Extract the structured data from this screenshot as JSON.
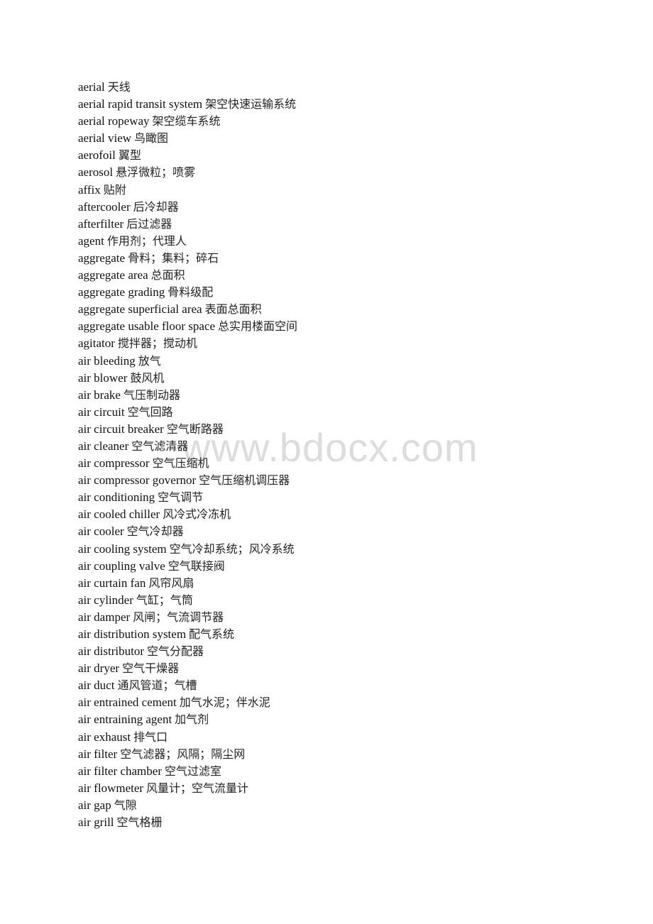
{
  "document": {
    "watermark": "www.bdocx.com",
    "entries": [
      {
        "term": "aerial",
        "definition": "天线"
      },
      {
        "term": "aerial rapid transit system",
        "definition": "架空快速运输系统"
      },
      {
        "term": "aerial ropeway",
        "definition": "架空缆车系统"
      },
      {
        "term": "aerial view",
        "definition": "鸟瞰图"
      },
      {
        "term": "aerofoil",
        "definition": "翼型"
      },
      {
        "term": "aerosol",
        "definition": "悬浮微粒；喷雾"
      },
      {
        "term": "affix",
        "definition": "贴附"
      },
      {
        "term": "aftercooler",
        "definition": "后冷却器"
      },
      {
        "term": "afterfilter",
        "definition": "后过滤器"
      },
      {
        "term": "agent",
        "definition": "作用剂；代理人"
      },
      {
        "term": "aggregate",
        "definition": "骨料；集料；碎石"
      },
      {
        "term": "aggregate area",
        "definition": "总面积"
      },
      {
        "term": "aggregate grading",
        "definition": "骨料级配"
      },
      {
        "term": "aggregate superficial area",
        "definition": "表面总面积"
      },
      {
        "term": "aggregate usable floor space",
        "definition": "总实用楼面空间"
      },
      {
        "term": "agitator",
        "definition": "搅拌器；搅动机"
      },
      {
        "term": "air bleeding",
        "definition": "放气"
      },
      {
        "term": "air blower",
        "definition": "鼓风机"
      },
      {
        "term": "air brake",
        "definition": "气压制动器"
      },
      {
        "term": "air circuit",
        "definition": "空气回路"
      },
      {
        "term": "air circuit breaker",
        "definition": "空气断路器"
      },
      {
        "term": "air cleaner",
        "definition": "空气滤清器"
      },
      {
        "term": "air compressor",
        "definition": "空气压缩机"
      },
      {
        "term": "air compressor governor",
        "definition": "空气压缩机调压器"
      },
      {
        "term": "air conditioning",
        "definition": "空气调节"
      },
      {
        "term": "air cooled chiller",
        "definition": "风冷式冷冻机"
      },
      {
        "term": "air cooler",
        "definition": "空气冷却器"
      },
      {
        "term": "air cooling system",
        "definition": "空气冷却系统；风冷系统"
      },
      {
        "term": "air coupling valve",
        "definition": "空气联接阀"
      },
      {
        "term": "air curtain fan",
        "definition": "风帘风扇"
      },
      {
        "term": "air cylinder",
        "definition": "气缸；气筒"
      },
      {
        "term": "air damper",
        "definition": "风闸；气流调节器"
      },
      {
        "term": "air distribution system",
        "definition": "配气系统"
      },
      {
        "term": "air distributor",
        "definition": "空气分配器"
      },
      {
        "term": "air dryer",
        "definition": "空气干燥器"
      },
      {
        "term": "air duct",
        "definition": "通风管道；气槽"
      },
      {
        "term": "air entrained cement",
        "definition": "加气水泥；伴水泥"
      },
      {
        "term": "air entraining agent",
        "definition": "加气剂"
      },
      {
        "term": "air exhaust",
        "definition": "排气口"
      },
      {
        "term": "air filter",
        "definition": "空气滤器；风隔；隔尘网"
      },
      {
        "term": "air filter chamber",
        "definition": "空气过滤室"
      },
      {
        "term": "air flowmeter",
        "definition": "风量计；空气流量计"
      },
      {
        "term": "air gap",
        "definition": "气隙"
      },
      {
        "term": "air grill",
        "definition": "空气格栅"
      }
    ]
  }
}
